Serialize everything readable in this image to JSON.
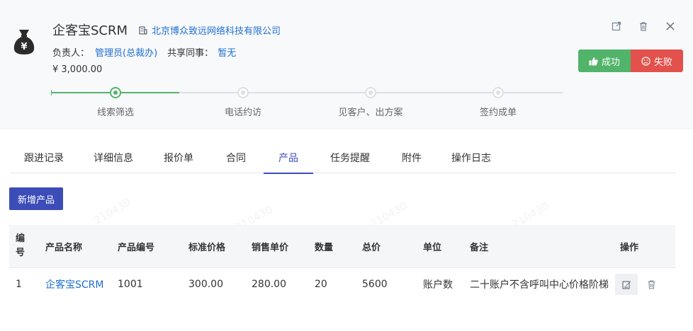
{
  "header": {
    "title": "企客宝SCRM",
    "company": "北京博众致远网络科技有限公司",
    "owner_label": "负责人：",
    "owner": "管理员(总裁办)",
    "shared_label": "共享同事：",
    "shared": "暂无",
    "amount": "¥ 3,000.00",
    "success_label": "成功",
    "fail_label": "失败",
    "accent": "#52b46a",
    "danger": "#e3514c"
  },
  "stages": {
    "items": [
      {
        "label": "线索筛选",
        "active": true
      },
      {
        "label": "电话约访",
        "active": false
      },
      {
        "label": "见客户、出方案",
        "active": false
      },
      {
        "label": "签约成单",
        "active": false
      }
    ]
  },
  "tabs": [
    {
      "label": "跟进记录",
      "active": false
    },
    {
      "label": "详细信息",
      "active": false
    },
    {
      "label": "报价单",
      "active": false
    },
    {
      "label": "合同",
      "active": false
    },
    {
      "label": "产品",
      "active": true
    },
    {
      "label": "任务提醒",
      "active": false
    },
    {
      "label": "附件",
      "active": false
    },
    {
      "label": "操作日志",
      "active": false
    }
  ],
  "add_button": "新增产品",
  "table": {
    "headers": [
      "编号",
      "产品名称",
      "产品编号",
      "标准价格",
      "销售单价",
      "数量",
      "总价",
      "单位",
      "备注",
      "操作"
    ],
    "rows": [
      {
        "index": "1",
        "name": "企客宝SCRM",
        "code": "1001",
        "std_price": "300.00",
        "sale_price": "280.00",
        "qty": "20",
        "total": "5600",
        "unit": "账户数",
        "note": "二十账户不含呼叫中心价格阶梯"
      }
    ]
  },
  "watermark": "210430",
  "theme": {
    "primary": "#3d4db8",
    "link": "#1e6fd0"
  }
}
